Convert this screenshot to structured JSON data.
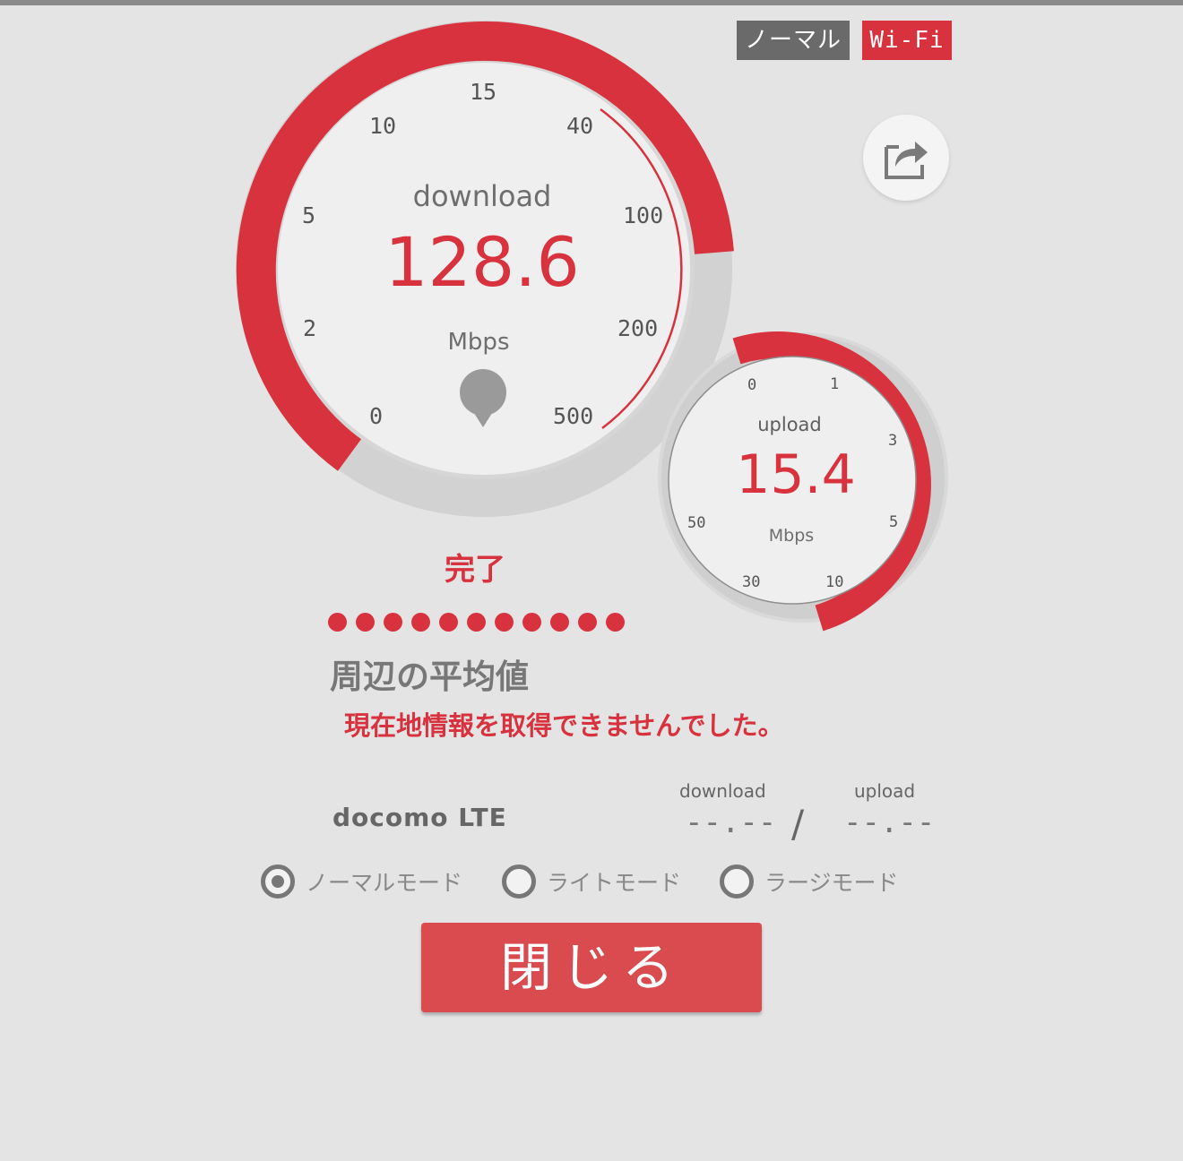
{
  "header": {
    "mode_badge": "ノーマル",
    "network_badge": "Wi-Fi"
  },
  "share_button": {
    "icon": "share-icon"
  },
  "download_gauge": {
    "label": "download",
    "value": "128.6",
    "unit": "Mbps",
    "ticks": [
      "0",
      "2",
      "5",
      "10",
      "15",
      "40",
      "100",
      "200",
      "500"
    ]
  },
  "upload_gauge": {
    "label": "upload",
    "value": "15.4",
    "unit": "Mbps",
    "ticks": [
      "0",
      "1",
      "3",
      "5",
      "10",
      "30",
      "50"
    ]
  },
  "status": "完了",
  "progress_dots": 11,
  "average": {
    "title": "周辺の平均値",
    "location_error": "現在地情報を取得できませんでした。",
    "carrier": "docomo  LTE",
    "download_label": "download",
    "upload_label": "upload",
    "download_value": "--.--",
    "upload_value": "--.--",
    "separator": "/"
  },
  "modes": {
    "options": [
      {
        "label": "ノーマルモード",
        "selected": true
      },
      {
        "label": "ライトモード",
        "selected": false
      },
      {
        "label": "ラージモード",
        "selected": false
      }
    ]
  },
  "close_button": "閉じる",
  "colors": {
    "accent": "#d8323e",
    "badge_gray": "#6a6a6a",
    "background": "#e4e4e4"
  }
}
